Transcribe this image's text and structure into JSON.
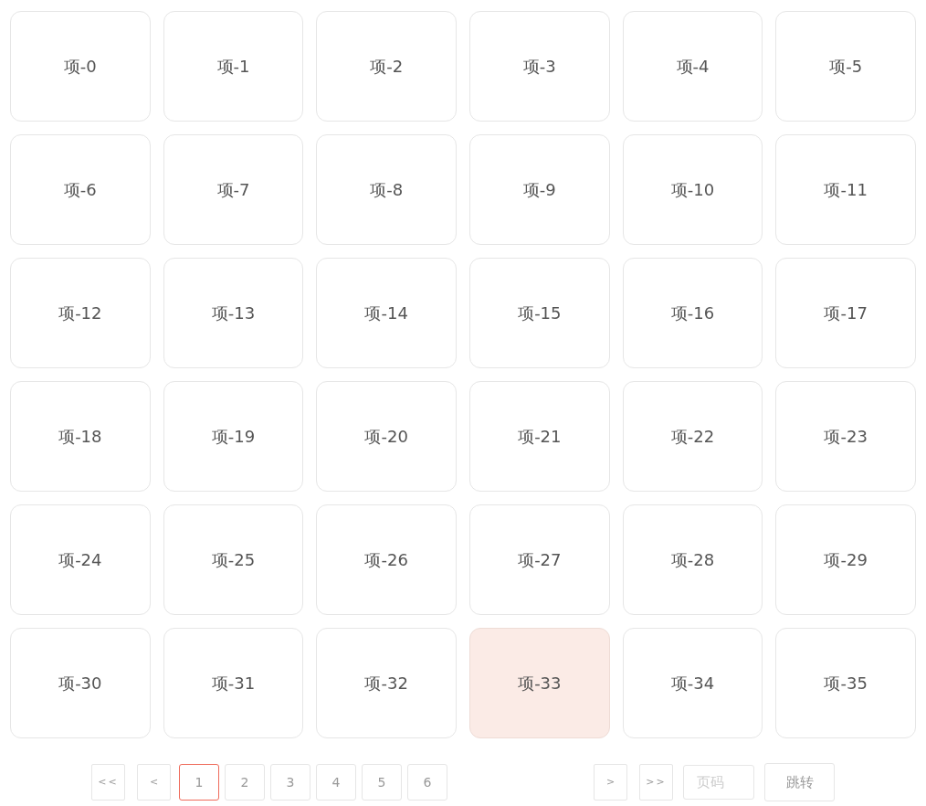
{
  "items": [
    {
      "label": "项-0",
      "highlighted": false
    },
    {
      "label": "项-1",
      "highlighted": false
    },
    {
      "label": "项-2",
      "highlighted": false
    },
    {
      "label": "项-3",
      "highlighted": false
    },
    {
      "label": "项-4",
      "highlighted": false
    },
    {
      "label": "项-5",
      "highlighted": false
    },
    {
      "label": "项-6",
      "highlighted": false
    },
    {
      "label": "项-7",
      "highlighted": false
    },
    {
      "label": "项-8",
      "highlighted": false
    },
    {
      "label": "项-9",
      "highlighted": false
    },
    {
      "label": "项-10",
      "highlighted": false
    },
    {
      "label": "项-11",
      "highlighted": false
    },
    {
      "label": "项-12",
      "highlighted": false
    },
    {
      "label": "项-13",
      "highlighted": false
    },
    {
      "label": "项-14",
      "highlighted": false
    },
    {
      "label": "项-15",
      "highlighted": false
    },
    {
      "label": "项-16",
      "highlighted": false
    },
    {
      "label": "项-17",
      "highlighted": false
    },
    {
      "label": "项-18",
      "highlighted": false
    },
    {
      "label": "项-19",
      "highlighted": false
    },
    {
      "label": "项-20",
      "highlighted": false
    },
    {
      "label": "项-21",
      "highlighted": false
    },
    {
      "label": "项-22",
      "highlighted": false
    },
    {
      "label": "项-23",
      "highlighted": false
    },
    {
      "label": "项-24",
      "highlighted": false
    },
    {
      "label": "项-25",
      "highlighted": false
    },
    {
      "label": "项-26",
      "highlighted": false
    },
    {
      "label": "项-27",
      "highlighted": false
    },
    {
      "label": "项-28",
      "highlighted": false
    },
    {
      "label": "项-29",
      "highlighted": false
    },
    {
      "label": "项-30",
      "highlighted": false
    },
    {
      "label": "项-31",
      "highlighted": false
    },
    {
      "label": "项-32",
      "highlighted": false
    },
    {
      "label": "项-33",
      "highlighted": true
    },
    {
      "label": "项-34",
      "highlighted": false
    },
    {
      "label": "项-35",
      "highlighted": false
    }
  ],
  "pagination": {
    "first": "<<",
    "prev": "<",
    "pages": [
      {
        "label": "1",
        "selected": true
      },
      {
        "label": "2",
        "selected": false
      },
      {
        "label": "3",
        "selected": false
      },
      {
        "label": "4",
        "selected": false
      },
      {
        "label": "5",
        "selected": false
      },
      {
        "label": "6",
        "selected": false
      }
    ],
    "next": ">",
    "last": ">>",
    "page_input": {
      "placeholder": "页码"
    },
    "jump_button": "跳转"
  }
}
